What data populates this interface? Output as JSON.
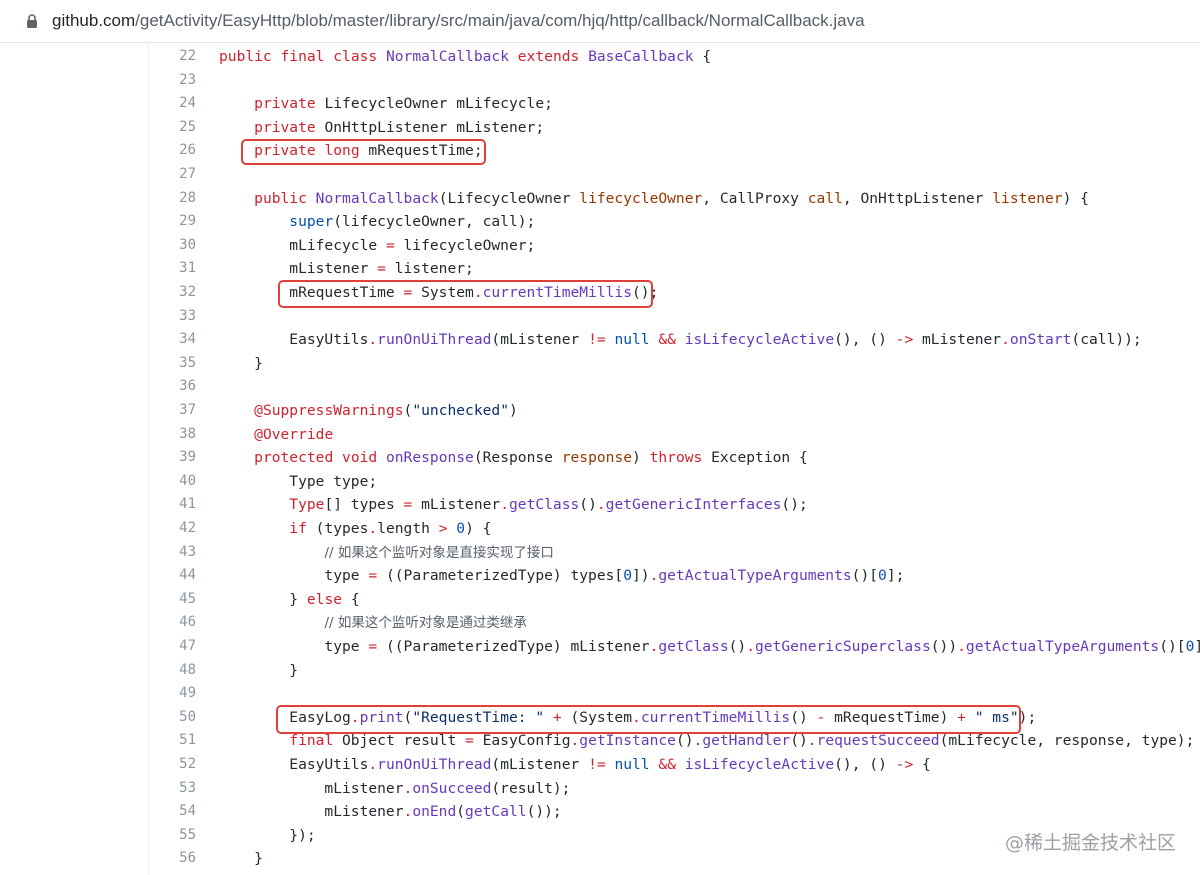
{
  "address_bar": {
    "host": "github.com",
    "path": "/getActivity/EasyHttp/blob/master/library/src/main/java/com/hjq/http/callback/NormalCallback.java"
  },
  "code": {
    "line_numbers": [
      "22",
      "23",
      "24",
      "25",
      "26",
      "27",
      "28",
      "29",
      "30",
      "31",
      "32",
      "33",
      "34",
      "35",
      "36",
      "37",
      "38",
      "39",
      "40",
      "41",
      "42",
      "43",
      "44",
      "45",
      "46",
      "47",
      "48",
      "49",
      "50",
      "51",
      "52",
      "53",
      "54",
      "55",
      "56"
    ],
    "comments": {
      "c43": "// 如果这个监听对象是直接实现了接口",
      "c46": "// 如果这个监听对象是通过类继承"
    },
    "highlighted_lines": [
      "26",
      "32",
      "50"
    ]
  },
  "watermark": "@稀土掘金技术社区",
  "colors": {
    "keyword": "#cf222e",
    "entity": "#6639ba",
    "function": "#0550ae",
    "param": "#953800",
    "string": "#0a3069",
    "highlight_box": "#e0403a"
  }
}
